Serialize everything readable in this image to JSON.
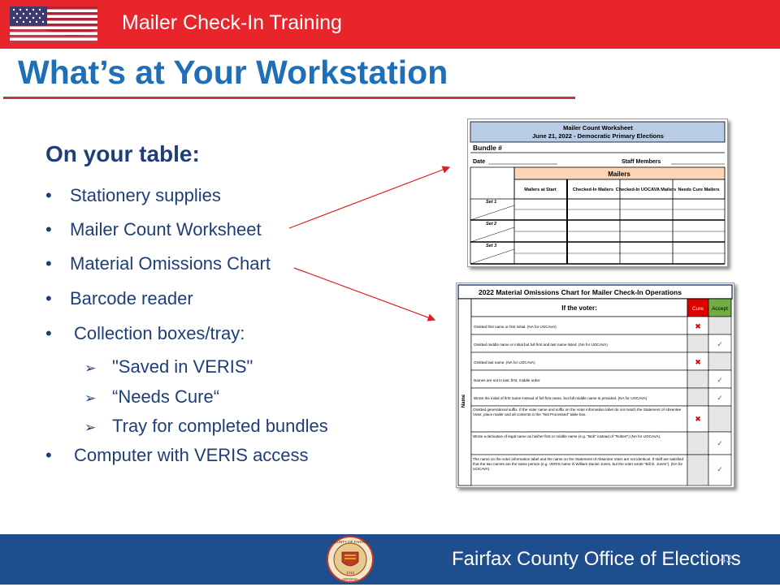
{
  "header": {
    "title": "Mailer Check-In Training"
  },
  "page": {
    "title": "What’s at Your Workstation"
  },
  "section": {
    "heading": "On your table:"
  },
  "bullets": [
    "Stationery supplies",
    "Mailer Count Worksheet",
    "Material Omissions Chart",
    "Barcode reader",
    "Collection boxes/tray:",
    "Computer with VERIS access"
  ],
  "sub_bullets": [
    "\"Saved in VERIS\"",
    "“Needs Cure“",
    "Tray for completed bundles"
  ],
  "worksheet": {
    "title": "Mailer Count Worksheet",
    "subtitle": "June 21, 2022 - Democratic Primary Elections",
    "bundle_label": "Bundle #",
    "date_label": "Date",
    "staff_label": "Staff Members",
    "group_header": "Mailers",
    "columns": [
      "Mailers at Start",
      "Checked-In Mailers",
      "Checked-In UOCAVA Mailers",
      "Needs Cure Mailers"
    ],
    "rows": [
      "Set 1",
      "Set 2",
      "Set 3"
    ]
  },
  "omissions_chart": {
    "title": "2022 Material Omissions Chart for Mailer Check-In Operations",
    "header": "If the voter:",
    "cure_label": "Cure",
    "accept_label": "Accept",
    "side_label": "Name",
    "rows": [
      {
        "text": "Omitted first name or first initial. (NA for UOCAVA)",
        "result": "cure"
      },
      {
        "text": "Omitted middle name or initial but full first and last name listed. (NA for UOCAVA)",
        "result": "accept"
      },
      {
        "text": "Omitted last name. (NA for UOCAVA)",
        "result": "cure"
      },
      {
        "text": "Names are not in last, first, middle order.",
        "result": "accept"
      },
      {
        "text": "Wrote the initial of first name instead of full first name, but full middle name is provided. (NA for UOCAVA)",
        "result": "accept"
      },
      {
        "text": "Omitted generational suffix. If the voter name and suffix on the voter information label do not match the Statement of Absentee Voter, place mailer and all contents in the \"Not Processed\" table box.",
        "result": "cure"
      },
      {
        "text": "Wrote a derivative of legal name as his/her first or middle name (e.g. \"Bob\" instead of \"Robert\") (NA for UOCAVA).",
        "result": "accept"
      },
      {
        "text": "The name on the voter information label and the name on the Statement of Absentee Voter are not identical. If staff are satisfied that the two names are the same person (e.g. VERIS name is William Daniel Jones, but the voter wrote \"Bill D. Jones\"). (NA for UOCAVA)",
        "result": "accept"
      }
    ]
  },
  "footer": {
    "org": "Fairfax County Office of Elections",
    "page_number": "42"
  },
  "seal": {
    "top_text": "COUNTY OF FAIRFAX",
    "bottom_text": "VIRGINIA",
    "year": "1742"
  },
  "colors": {
    "header_red": "#e8252a",
    "title_blue": "#1f6fb6",
    "text_navy": "#1f3e78",
    "footer_blue": "#1f4e8e",
    "arrow_red": "#e0201e"
  }
}
